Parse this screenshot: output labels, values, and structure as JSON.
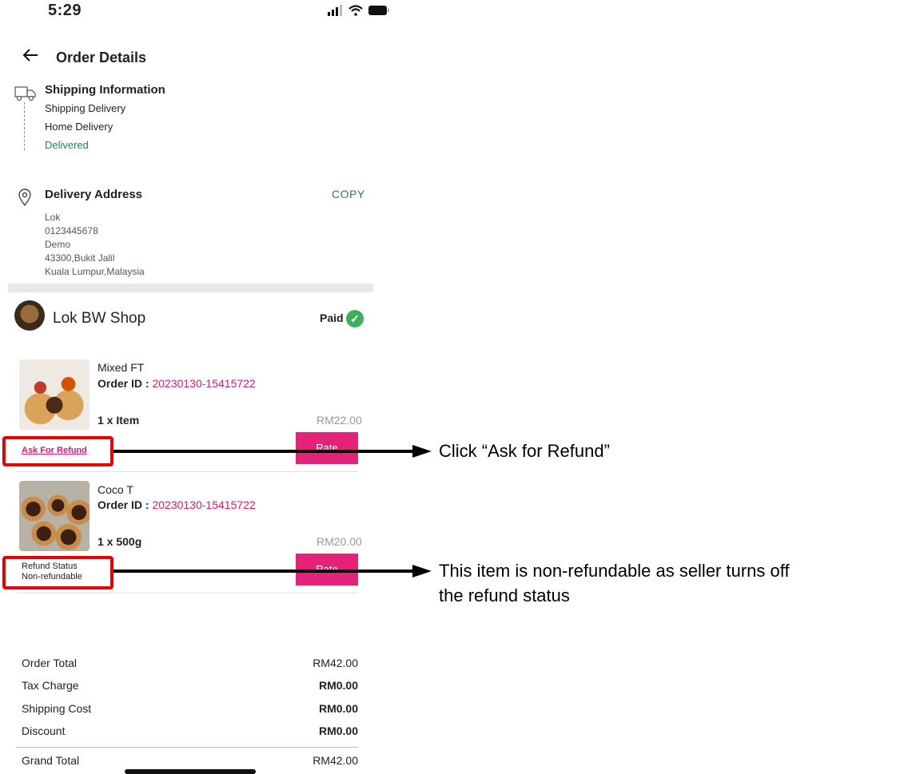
{
  "status_bar": {
    "time": "5:29"
  },
  "header": {
    "title": "Order Details"
  },
  "shipping": {
    "title": "Shipping Information",
    "lines": [
      "Shipping Delivery",
      "Home Delivery"
    ],
    "status": "Delivered"
  },
  "address": {
    "title": "Delivery Address",
    "copy_label": "COPY",
    "lines": [
      "Lok",
      "0123445678",
      "Demo",
      "43300,Bukit Jalil",
      "Kuala Lumpur,Malaysia"
    ]
  },
  "shop": {
    "name": "Lok BW Shop",
    "payment_status": "Paid"
  },
  "items": [
    {
      "name": "Mixed FT",
      "order_id_label": "Order ID :",
      "order_id": "20230130-15415722",
      "qty": "1 x Item",
      "price": "RM22.00",
      "action_label": "Ask For Refund",
      "rate_label": "Rate"
    },
    {
      "name": "Coco T",
      "order_id_label": "Order ID :",
      "order_id": "20230130-15415722",
      "qty": "1 x 500g",
      "price": "RM20.00",
      "refund_status_label": "Refund Status",
      "refund_status_value": "Non-refundable",
      "rate_label": "Rate"
    }
  ],
  "annotations": {
    "refund": "Click “Ask for Refund”",
    "nonrefundable_line1": "This item is non-refundable as seller turns off",
    "nonrefundable_line2": "the refund status"
  },
  "summary": [
    {
      "label": "Order Total",
      "value": "RM42.00"
    },
    {
      "label": "Tax Charge",
      "value": "RM0.00"
    },
    {
      "label": "Shipping Cost",
      "value": "RM0.00"
    },
    {
      "label": "Discount",
      "value": "RM0.00"
    },
    {
      "label": "Grand Total",
      "value": "RM42.00"
    }
  ],
  "colors": {
    "accent": "#e5227a",
    "link": "#d81b73",
    "teal": "#2a7a6a",
    "highlight": "#e60000",
    "paid": "#3bb05a"
  },
  "icons": [
    "back-arrow-icon",
    "truck-icon",
    "location-pin-icon",
    "check-icon",
    "signal-icon",
    "wifi-icon",
    "battery-icon"
  ]
}
